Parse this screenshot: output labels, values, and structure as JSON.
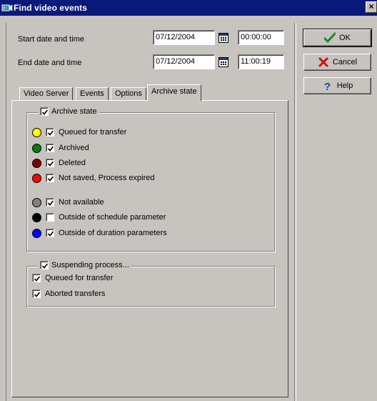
{
  "window": {
    "title": "Find video events",
    "close_glyph": "×"
  },
  "criteria": {
    "start_label": "Start date and time",
    "start_date": "07/12/2004",
    "start_time": "00:00:00",
    "end_label": "End date and time",
    "end_date": "07/12/2004",
    "end_time": "11:00:19"
  },
  "buttons": {
    "ok": "OK",
    "cancel": "Cancel",
    "help": "Help"
  },
  "tabs": [
    {
      "label": "Video Server"
    },
    {
      "label": "Events"
    },
    {
      "label": "Options"
    },
    {
      "label": "Archive state",
      "active": true
    }
  ],
  "archive_state": {
    "label": "Archive state",
    "checked": true,
    "items": [
      {
        "label": "Queued for transfer",
        "color": "#ffff00",
        "checked": true
      },
      {
        "label": "Archived",
        "color": "#008000",
        "checked": true
      },
      {
        "label": "Deleted",
        "color": "#800000",
        "checked": true
      },
      {
        "label": "Not saved, Process expired",
        "color": "#ff0000",
        "checked": true
      },
      {
        "label": "Not available",
        "color": "#808080",
        "checked": true
      },
      {
        "label": "Outside of schedule parameter",
        "color": "#000000",
        "checked": false
      },
      {
        "label": "Outside of duration parameters",
        "color": "#0000ff",
        "checked": true
      }
    ]
  },
  "suspending": {
    "label": "Suspending process...",
    "checked": true,
    "items": [
      {
        "label": "Queued for transfer",
        "checked": true
      },
      {
        "label": "Aborted transfers",
        "checked": true
      }
    ]
  },
  "icons": {
    "app": "video-camera-icon",
    "calendar": "calendar-icon",
    "ok": "checkmark-icon",
    "cancel": "cross-icon",
    "help": "question-mark-icon"
  }
}
